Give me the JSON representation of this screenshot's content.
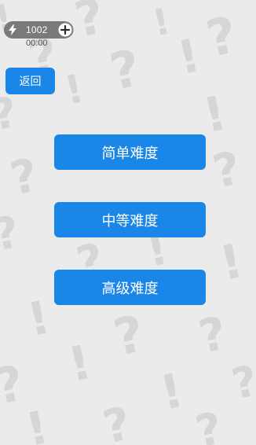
{
  "status": {
    "energy_value": "1002",
    "timer": "00:00"
  },
  "nav": {
    "back_label": "返回"
  },
  "difficulty": {
    "easy_label": "简单难度",
    "medium_label": "中等难度",
    "hard_label": "高级难度"
  },
  "icons": {
    "energy": "lightning-bolt-icon",
    "add": "plus-circle-icon"
  },
  "colors": {
    "button_bg": "#1a86e8",
    "page_bg": "#ebebeb",
    "pattern": "#d6d6d6",
    "energy_bar": "#7a7a7a"
  }
}
